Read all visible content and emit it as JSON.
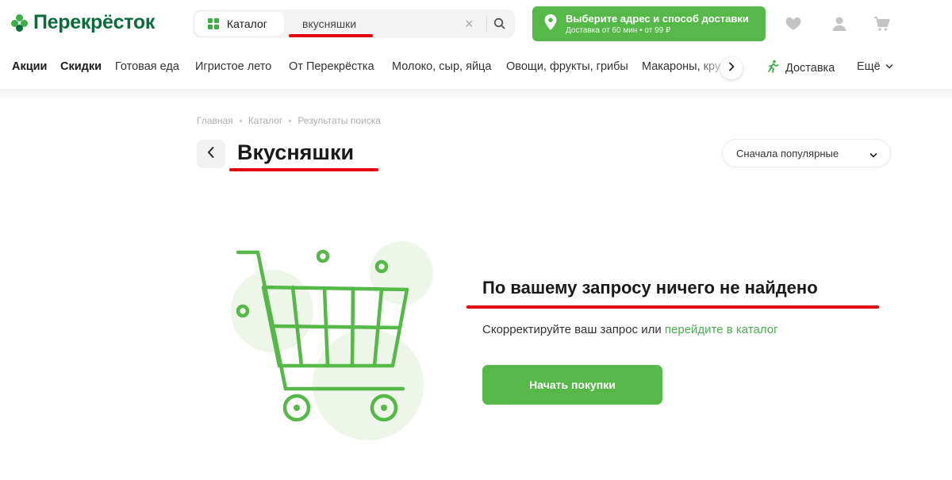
{
  "header": {
    "logo_text": "Перекрёсток",
    "catalog_label": "Каталог",
    "search": {
      "value": "вкусняшки",
      "placeholder": ""
    },
    "delivery": {
      "title": "Выберите адрес и способ доставки",
      "subtitle": "Доставка от 60 мин • от 99 ₽"
    },
    "icons": [
      "heart-icon",
      "user-icon",
      "cart-icon"
    ]
  },
  "nav": {
    "items": [
      {
        "label": "Акции",
        "bold": true
      },
      {
        "label": "Скидки",
        "bold": true
      },
      {
        "label": "Готовая еда",
        "bold": false
      },
      {
        "label": "Игристое лето",
        "bold": false
      },
      {
        "label": "От Перекрёстка",
        "bold": false
      },
      {
        "label": "Молоко, сыр, яйца",
        "bold": false
      },
      {
        "label": "Овощи, фрукты, грибы",
        "bold": false
      },
      {
        "label": "Макароны, кру",
        "bold": false
      }
    ],
    "delivery_label": "Доставка",
    "more_label": "Ещё"
  },
  "breadcrumb": [
    "Главная",
    "Каталог",
    "Результаты поиска"
  ],
  "page": {
    "title": "Вкусняшки",
    "sort_label": "Сначала популярные"
  },
  "empty_state": {
    "title": "По вашему запросу ничего не найдено",
    "text": "Скорректируйте ваш запрос или ",
    "link": "перейдите в каталог",
    "button": "Начать покупки"
  },
  "colors": {
    "brand_green": "#55b848",
    "logo_green": "#0b6b3a",
    "annotation_red": "#e3000f"
  }
}
